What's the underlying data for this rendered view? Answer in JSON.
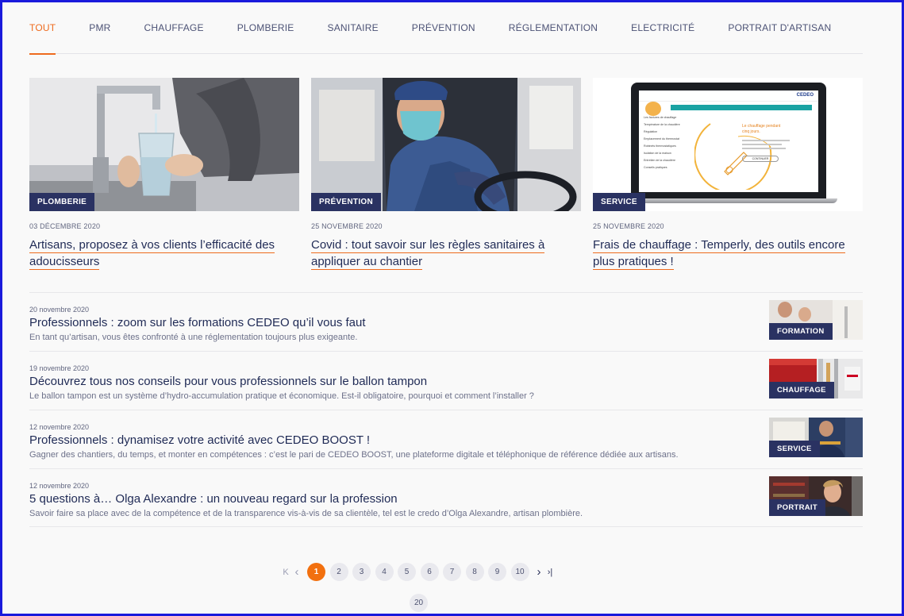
{
  "tabs": [
    {
      "label": "TOUT"
    },
    {
      "label": "PMR"
    },
    {
      "label": "CHAUFFAGE"
    },
    {
      "label": "PLOMBERIE"
    },
    {
      "label": "SANITAIRE"
    },
    {
      "label": "PRÉVENTION"
    },
    {
      "label": "RÉGLEMENTATION"
    },
    {
      "label": "ELECTRICITÉ"
    },
    {
      "label": "PORTRAIT D'ARTISAN"
    }
  ],
  "featured": [
    {
      "badge": "PLOMBERIE",
      "date": "03 DÉCEMBRE 2020",
      "title_line1": "Artisans, proposez à vos clients l’efficacité des",
      "title_line2": "adoucisseurs"
    },
    {
      "badge": "PRÉVENTION",
      "date": "25 NOVEMBRE 2020",
      "title_line1": "Covid : tout savoir sur les règles sanitaires à",
      "title_line2": "appliquer au chantier"
    },
    {
      "badge": "SERVICE",
      "date": "25 NOVEMBRE 2020",
      "title_line1": "Frais de chauffage : Temperly, des outils encore",
      "title_line2": "plus pratiques !",
      "screen_logo": "CEDEO",
      "screen_heading_1": "Le chauffage pendant",
      "screen_heading_2": "cinq jours.",
      "screen_button": "CONTINUER",
      "screen_items": [
        "Les factures de chauffage",
        "Température de la chaudière",
        "Régulation",
        "Emplacement du thermostat",
        "Robinets thermostatiques",
        "Isolation de la maison",
        "Entretien de la chaudière",
        "Conseils pratiques"
      ]
    }
  ],
  "articles": [
    {
      "date": "20 novembre 2020",
      "title": "Professionnels : zoom sur les formations CEDEO qu’il vous faut",
      "desc": "En tant qu’artisan, vous êtes confronté à une réglementation toujours plus exigeante.",
      "badge": "FORMATION"
    },
    {
      "date": "19 novembre 2020",
      "title": "Découvrez tous nos conseils pour vous professionnels sur le ballon tampon",
      "desc": "Le ballon tampon est un système d’hydro-accumulation pratique et économique. Est-il obligatoire, pourquoi et comment l’installer ?",
      "badge": "CHAUFFAGE"
    },
    {
      "date": "12 novembre 2020",
      "title": "Professionnels : dynamisez votre activité avec CEDEO BOOST !",
      "desc": "Gagner des chantiers, du temps, et monter en compétences : c’est le pari de CEDEO BOOST, une plateforme digitale et téléphonique de référence dédiée aux artisans.",
      "badge": "SERVICE"
    },
    {
      "date": "12 novembre 2020",
      "title": "5 questions à… Olga Alexandre : un nouveau regard sur la profession",
      "desc": "Savoir faire sa place avec de la compétence et de la transparence vis-à-vis de sa clientèle, tel est le credo d’Olga Alexandre, artisan plombière.",
      "badge": "PORTRAIT"
    }
  ],
  "pagination": {
    "first": "K",
    "prev": "‹",
    "pages": [
      "1",
      "2",
      "3",
      "4",
      "5",
      "6",
      "7",
      "8",
      "9",
      "10"
    ],
    "current": "1",
    "next": "›",
    "last": "›|",
    "extra": "20"
  },
  "colors": {
    "accent": "#ee6b1e",
    "navy": "#2a3262",
    "frame": "#1a1adc"
  }
}
